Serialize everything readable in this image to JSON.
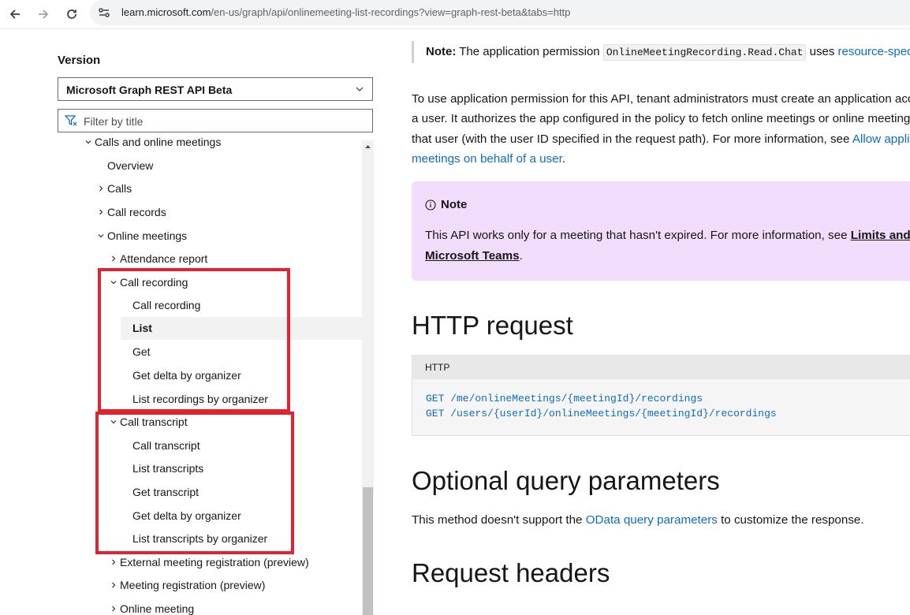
{
  "browser": {
    "url_host": "learn.microsoft.com",
    "url_path": "/en-us/graph/api/onlinemeeting-list-recordings?view=graph-rest-beta&tabs=http"
  },
  "sidebar": {
    "version_label": "Version",
    "version_value": "Microsoft Graph REST API Beta",
    "filter_placeholder": "Filter by title",
    "toc": [
      {
        "label": "Calls and online meetings",
        "expanded": true
      },
      {
        "label": "Overview"
      },
      {
        "label": "Calls",
        "expanded": false
      },
      {
        "label": "Call records",
        "expanded": false
      },
      {
        "label": "Online meetings",
        "expanded": true
      },
      {
        "label": "Attendance report",
        "expanded": false
      },
      {
        "label": "Call recording",
        "expanded": true
      },
      {
        "label": "Call recording"
      },
      {
        "label": "List",
        "selected": true
      },
      {
        "label": "Get"
      },
      {
        "label": "Get delta by organizer"
      },
      {
        "label": "List recordings by organizer"
      },
      {
        "label": "Call transcript",
        "expanded": true
      },
      {
        "label": "Call transcript"
      },
      {
        "label": "List transcripts"
      },
      {
        "label": "Get transcript"
      },
      {
        "label": "Get delta by organizer"
      },
      {
        "label": "List transcripts by organizer"
      },
      {
        "label": "External meeting registration (preview)",
        "expanded": false
      },
      {
        "label": "Meeting registration (preview)",
        "expanded": false
      },
      {
        "label": "Online meeting",
        "expanded": false
      }
    ]
  },
  "main": {
    "note_top": {
      "bold": "Note:",
      "text1": " The application permission ",
      "code": "OnlineMeetingRecording.Read.Chat",
      "text2": " uses ",
      "link": "resource-specific consent"
    },
    "para1": {
      "line1": "To use application permission for this API, tenant administrators must create an application access policy and grant it to",
      "line2": "a user. It authorizes the app configured in the policy to fetch online meetings or online meeting artifacts on behalf of",
      "line3_text": "that user (with the user ID specified in the request path). For more information, see ",
      "line3_link": "Allow applications to access online",
      "line4_link": "meetings on behalf of a user",
      "line4_text": "."
    },
    "note_box": {
      "title": "Note",
      "line1_text": "This API works only for a meeting that hasn't expired. For more information, see ",
      "line1_link": "Limits and specifications for",
      "line2_link": "Microsoft Teams",
      "line2_text": "."
    },
    "http_heading": "HTTP request",
    "code": {
      "lang": "HTTP",
      "line1": "GET /me/onlineMeetings/{meetingId}/recordings",
      "line2": "GET /users/{userId}/onlineMeetings/{meetingId}/recordings"
    },
    "optional_heading": "Optional query parameters",
    "optional_para": {
      "text1": "This method doesn't support the ",
      "link": "OData query parameters",
      "text2": " to customize the response."
    },
    "headers_heading": "Request headers"
  },
  "colors": {
    "highlight": "#e0232e",
    "link": "#0f6cbd",
    "note_bg": "#f2dcfc"
  }
}
